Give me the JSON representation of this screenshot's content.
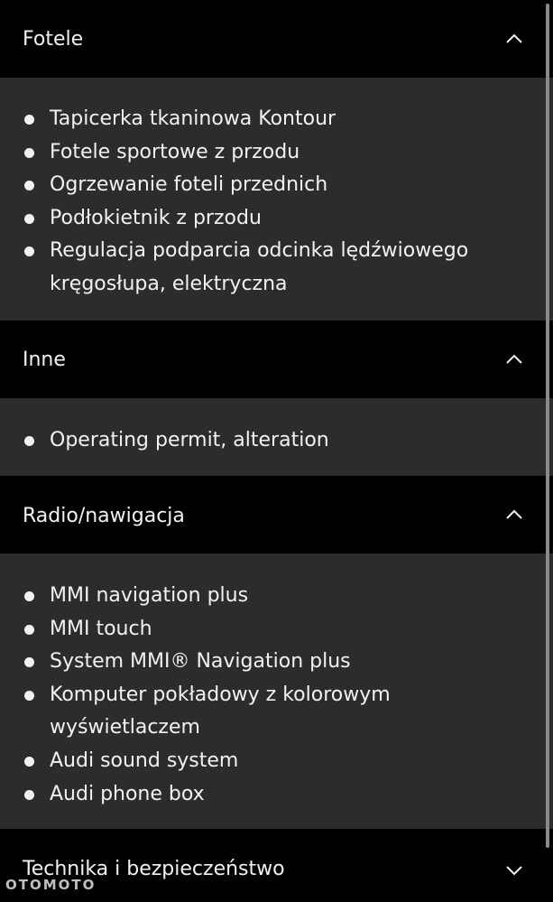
{
  "sections": [
    {
      "title": "Fotele",
      "expanded": true,
      "chevron_icon": "chevron-up-icon",
      "items": [
        "Tapicerka tkaninowa Kontour",
        "Fotele sportowe z przodu",
        "Ogrzewanie foteli przednich",
        "Podłokietnik z przodu",
        "Regulacja podparcia odcinka lędźwiowego kręgosłupa, elektryczna"
      ]
    },
    {
      "title": "Inne",
      "expanded": true,
      "chevron_icon": "chevron-up-icon",
      "items": [
        "Operating permit, alteration"
      ]
    },
    {
      "title": "Radio/nawigacja",
      "expanded": true,
      "chevron_icon": "chevron-up-icon",
      "items": [
        "MMI navigation plus",
        "MMI touch",
        "System MMI® Navigation plus",
        "Komputer pokładowy z kolorowym wyświetlaczem",
        "Audi sound system",
        "Audi phone box"
      ]
    },
    {
      "title": "Technika i bezpieczeństwo",
      "expanded": false,
      "chevron_icon": "chevron-down-icon",
      "items": []
    }
  ],
  "watermark": "OTOMOTO",
  "colors": {
    "header_bg": "#000000",
    "body_bg": "#2c2c2c",
    "text": "#f2f2f2"
  }
}
